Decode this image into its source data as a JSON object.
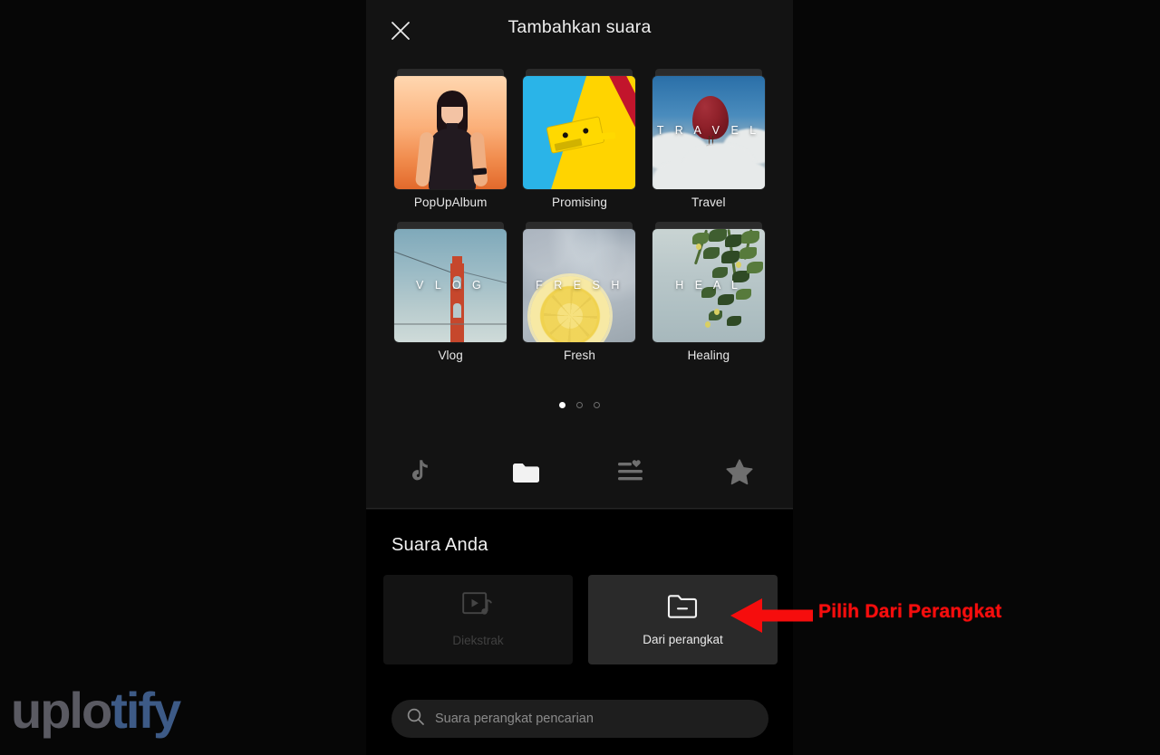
{
  "header": {
    "title": "Tambahkan suara",
    "close_icon": "close-icon"
  },
  "sound_library": {
    "items": [
      {
        "caption": "PopUpAlbum",
        "overlay": "",
        "art": "pop"
      },
      {
        "caption": "Promising",
        "overlay": "",
        "art": "prom"
      },
      {
        "caption": "Travel",
        "overlay": "T R A V E L",
        "art": "travel"
      },
      {
        "caption": "Vlog",
        "overlay": "V L O G",
        "art": "vlog"
      },
      {
        "caption": "Fresh",
        "overlay": "F R E S H",
        "art": "fresh"
      },
      {
        "caption": "Healing",
        "overlay": "H E A L",
        "art": "heal"
      }
    ],
    "pager": {
      "total": 3,
      "active_index": 0
    }
  },
  "tabbar": {
    "tabs": [
      {
        "icon": "tiktok-note-icon",
        "active": false
      },
      {
        "icon": "folder-icon",
        "active": true
      },
      {
        "icon": "playlist-heart-icon",
        "active": false
      },
      {
        "icon": "star-icon",
        "active": false
      }
    ]
  },
  "your_sound": {
    "title": "Suara Anda",
    "sources": [
      {
        "label": "Diekstrak",
        "icon": "extract-video-music-icon",
        "disabled": true
      },
      {
        "label": "Dari perangkat",
        "icon": "folder-minus-icon",
        "disabled": false
      }
    ],
    "search": {
      "placeholder": "Suara perangkat pencarian",
      "value": "",
      "icon": "search-icon"
    }
  },
  "annotation": {
    "text": "Pilih Dari Perangkat",
    "color": "#f60d0d",
    "arrow_icon": "arrow-left-icon"
  },
  "watermark": {
    "part_a": "uplo",
    "part_b": "tify"
  }
}
